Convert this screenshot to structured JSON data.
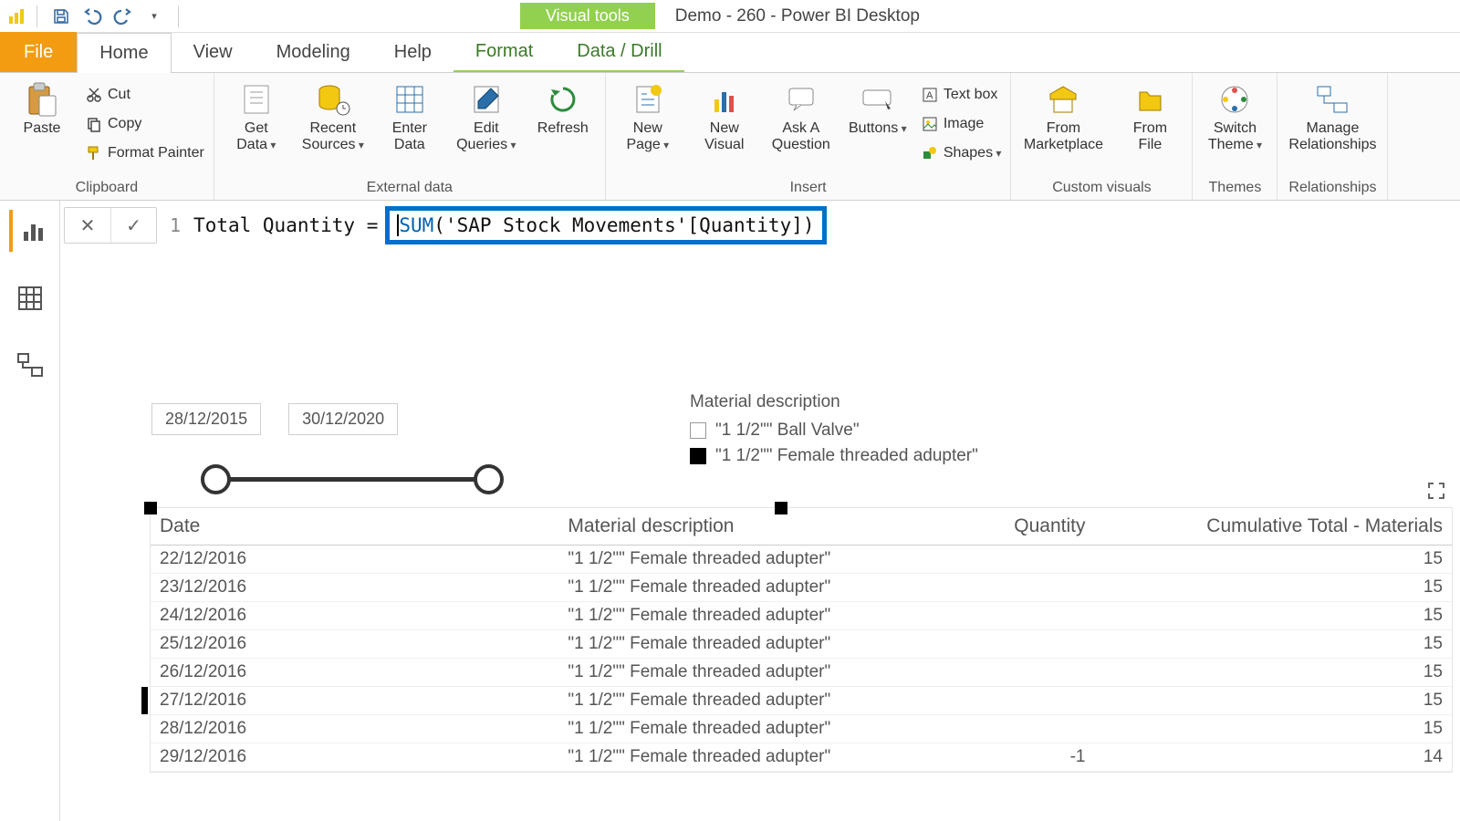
{
  "window": {
    "title": "Demo - 260 - Power BI Desktop",
    "visual_tools": "Visual tools"
  },
  "tabs": {
    "file": "File",
    "home": "Home",
    "view": "View",
    "modeling": "Modeling",
    "help": "Help",
    "format": "Format",
    "data_drill": "Data / Drill"
  },
  "ribbon": {
    "clipboard": {
      "label": "Clipboard",
      "paste": "Paste",
      "cut": "Cut",
      "copy": "Copy",
      "format_painter": "Format Painter"
    },
    "external_data": {
      "label": "External data",
      "get_data": "Get\nData",
      "recent_sources": "Recent\nSources",
      "enter_data": "Enter\nData",
      "edit_queries": "Edit\nQueries",
      "refresh": "Refresh"
    },
    "insert": {
      "label": "Insert",
      "new_page": "New\nPage",
      "new_visual": "New\nVisual",
      "ask_q": "Ask A\nQuestion",
      "buttons": "Buttons",
      "text_box": "Text box",
      "image": "Image",
      "shapes": "Shapes"
    },
    "custom_visuals": {
      "label": "Custom visuals",
      "marketplace": "From\nMarketplace",
      "from_file": "From\nFile"
    },
    "themes": {
      "label": "Themes",
      "switch_theme": "Switch\nTheme"
    },
    "relationships": {
      "label": "Relationships",
      "manage": "Manage\nRelationships"
    }
  },
  "formula": {
    "line": "1",
    "measure_name": "Total Quantity =",
    "fn": "SUM",
    "expr_tail": "('SAP Stock Movements'[Quantity])"
  },
  "slicer": {
    "from": "28/12/2015",
    "to": "30/12/2020"
  },
  "legend": {
    "title": "Material description",
    "items": [
      {
        "label": "\"1 1/2\"\" Ball Valve\"",
        "checked": false
      },
      {
        "label": "\"1 1/2\"\" Female threaded adupter\"",
        "checked": true
      }
    ]
  },
  "table": {
    "headers": {
      "date": "Date",
      "material": "Material description",
      "qty": "Quantity",
      "cum": "Cumulative Total - Materials"
    },
    "rows": [
      {
        "date": "22/12/2016",
        "material": "\"1 1/2\"\" Female threaded adupter\"",
        "qty": "",
        "cum": "15"
      },
      {
        "date": "23/12/2016",
        "material": "\"1 1/2\"\" Female threaded adupter\"",
        "qty": "",
        "cum": "15"
      },
      {
        "date": "24/12/2016",
        "material": "\"1 1/2\"\" Female threaded adupter\"",
        "qty": "",
        "cum": "15"
      },
      {
        "date": "25/12/2016",
        "material": "\"1 1/2\"\" Female threaded adupter\"",
        "qty": "",
        "cum": "15"
      },
      {
        "date": "26/12/2016",
        "material": "\"1 1/2\"\" Female threaded adupter\"",
        "qty": "",
        "cum": "15"
      },
      {
        "date": "27/12/2016",
        "material": "\"1 1/2\"\" Female threaded adupter\"",
        "qty": "",
        "cum": "15"
      },
      {
        "date": "28/12/2016",
        "material": "\"1 1/2\"\" Female threaded adupter\"",
        "qty": "",
        "cum": "15"
      },
      {
        "date": "29/12/2016",
        "material": "\"1 1/2\"\" Female threaded adupter\"",
        "qty": "-1",
        "cum": "14"
      }
    ]
  }
}
